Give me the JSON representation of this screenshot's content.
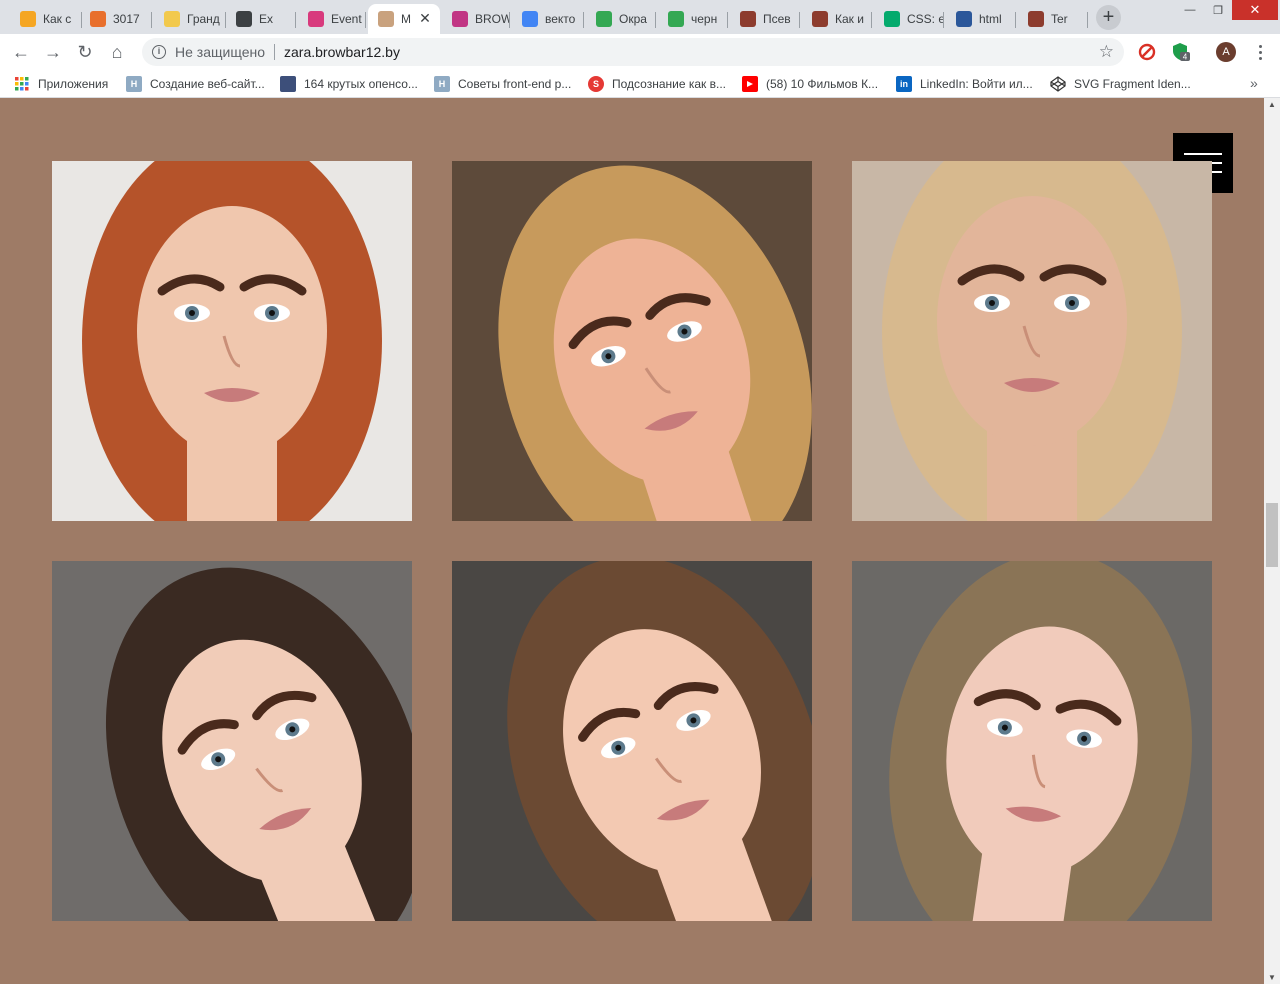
{
  "browser": {
    "tabs": [
      {
        "title": "Как с",
        "icon": "orange-icon",
        "color": "#f5a623"
      },
      {
        "title": "3017",
        "icon": "glasses-icon",
        "color": "#e86f2c"
      },
      {
        "title": "Гранд",
        "icon": "emoji-icon",
        "color": "#f2c94c"
      },
      {
        "title": "Ex",
        "icon": "play-icon",
        "color": "#3c4043"
      },
      {
        "title": "Event",
        "icon": "e-letter-icon",
        "color": "#d83a7d"
      },
      {
        "title": "M",
        "icon": "site-logo-icon",
        "color": "#c9a27e",
        "active": true
      },
      {
        "title": "BROW",
        "icon": "instagram-icon",
        "color": "#c13584"
      },
      {
        "title": "векто",
        "icon": "google-icon",
        "color": "#4285f4"
      },
      {
        "title": "Окра",
        "icon": "green-circle-icon",
        "color": "#34a853"
      },
      {
        "title": "черн",
        "icon": "green-circle-icon",
        "color": "#34a853"
      },
      {
        "title": "Псев",
        "icon": "brick-icon",
        "color": "#8d3c2e"
      },
      {
        "title": "Как и",
        "icon": "brick-icon",
        "color": "#8d3c2e"
      },
      {
        "title": "CSS: e",
        "icon": "w3-icon",
        "color": "#04aa6d"
      },
      {
        "title": "html",
        "icon": "doc-icon",
        "color": "#2b579a"
      },
      {
        "title": "Ter",
        "icon": "brick-icon",
        "color": "#8d3c2e"
      }
    ],
    "address": {
      "security_label": "Не защищено",
      "url": "zara.browbar12.by"
    },
    "extension_badge": "4",
    "avatar_letter": "A",
    "bookmarks": [
      {
        "label": "Приложения",
        "icon": "apps-grid-icon"
      },
      {
        "label": "Создание веб-сайт...",
        "icon": "h-letter-icon"
      },
      {
        "label": "164 крутых опенсо...",
        "icon": "flag-icon"
      },
      {
        "label": "Советы front-end p...",
        "icon": "h-letter-icon"
      },
      {
        "label": "Подсознание как в...",
        "icon": "s-logo-icon"
      },
      {
        "label": "(58) 10 Фильмов К...",
        "icon": "youtube-icon"
      },
      {
        "label": "LinkedIn: Войти ил...",
        "icon": "linkedin-icon"
      },
      {
        "label": "SVG Fragment Iden...",
        "icon": "codepen-icon"
      }
    ]
  },
  "page": {
    "background": "#9e7b66",
    "menu_button": "hamburger-menu-icon",
    "gallery": [
      {
        "name": "portrait-redhead",
        "hair": "#b5532a",
        "skin": "#f0c7ae",
        "bg": "#e9e7e4"
      },
      {
        "name": "portrait-blonde-angled",
        "hair": "#c79a5c",
        "skin": "#eeb396",
        "bg": "#5d4a3a"
      },
      {
        "name": "portrait-light-blonde",
        "hair": "#d7b98e",
        "skin": "#e2b59a",
        "bg": "#c8b7a6"
      },
      {
        "name": "portrait-brunette-angled",
        "hair": "#3a2a22",
        "skin": "#f1ccb8",
        "bg": "#6f6c6a"
      },
      {
        "name": "portrait-brown-hair-blue-eyes",
        "hair": "#6b4a33",
        "skin": "#f3c9b2",
        "bg": "#4a4744"
      },
      {
        "name": "portrait-ash-blonde-piercing",
        "hair": "#8a7456",
        "skin": "#f1cbbb",
        "bg": "#6b6966"
      }
    ]
  }
}
